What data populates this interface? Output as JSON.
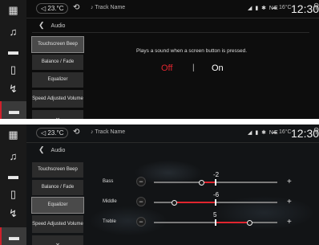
{
  "status_bar": {
    "temperature": "23.°C",
    "track_name": "Track Name",
    "status_icons": "◢ ▮ ✱ NE",
    "outside_temp": "16°C",
    "clock": "12:30"
  },
  "sidebar": {
    "items": [
      {
        "icon": "grid-icon",
        "glyph": "▦"
      },
      {
        "icon": "music-icon",
        "glyph": "♫"
      },
      {
        "icon": "radio-icon",
        "glyph": "📻"
      },
      {
        "icon": "phone-icon",
        "glyph": "▯"
      },
      {
        "icon": "navigation-icon",
        "glyph": "⤳"
      },
      {
        "icon": "car-icon",
        "glyph": "🚘"
      }
    ]
  },
  "audio_screen_1": {
    "breadcrumb": "Audio",
    "menu": [
      "Touchscreen Beep",
      "Balance / Fade",
      "Equalizer",
      "Speed Adjusted Volume"
    ],
    "selected": "Touchscreen Beep",
    "description": "Plays a sound when a screen button is pressed.",
    "off_label": "Off",
    "separator": "|",
    "on_label": "On",
    "current_value": "Off"
  },
  "audio_screen_2": {
    "breadcrumb": "Audio",
    "menu": [
      "Touchscreen Beep",
      "Balance / Fade",
      "Equalizer",
      "Speed Adjusted Volume"
    ],
    "selected": "Equalizer",
    "bands": [
      {
        "label": "Bass",
        "value": "-2",
        "level": -2
      },
      {
        "label": "Middle",
        "value": "-6",
        "level": -6
      },
      {
        "label": "Treble",
        "value": "5",
        "level": 5
      }
    ],
    "minus_label": "−",
    "plus_label": "+",
    "accent_color": "#e0252f"
  }
}
